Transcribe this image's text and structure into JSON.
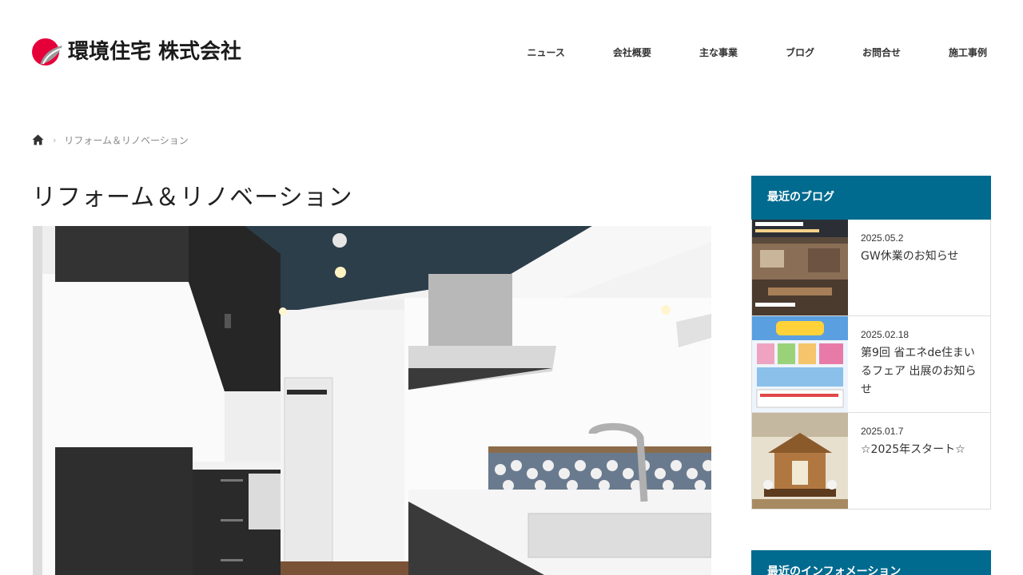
{
  "header": {
    "logo_text": "環境住宅 株式会社",
    "nav": [
      "ニュース",
      "会社概要",
      "主な事業",
      "ブログ",
      "お問合せ",
      "施工事例"
    ]
  },
  "breadcrumb": {
    "current": "リフォーム＆リノベーション"
  },
  "main": {
    "title": "リフォーム＆リノベーション"
  },
  "sidebar": {
    "blog_heading": "最近のブログ",
    "posts": [
      {
        "date": "2025.05.2",
        "title": "GW休業のお知らせ"
      },
      {
        "date": "2025.02.18",
        "title": "第9回 省エネde住まいるフェア 出展のお知らせ"
      },
      {
        "date": "2025.01.7",
        "title": "☆2025年スタート☆"
      }
    ],
    "info_heading": "最近のインフォメーション"
  },
  "colors": {
    "accent": "#006b8f",
    "logo_red": "#e6003a",
    "logo_gray": "#8a8a8a"
  }
}
